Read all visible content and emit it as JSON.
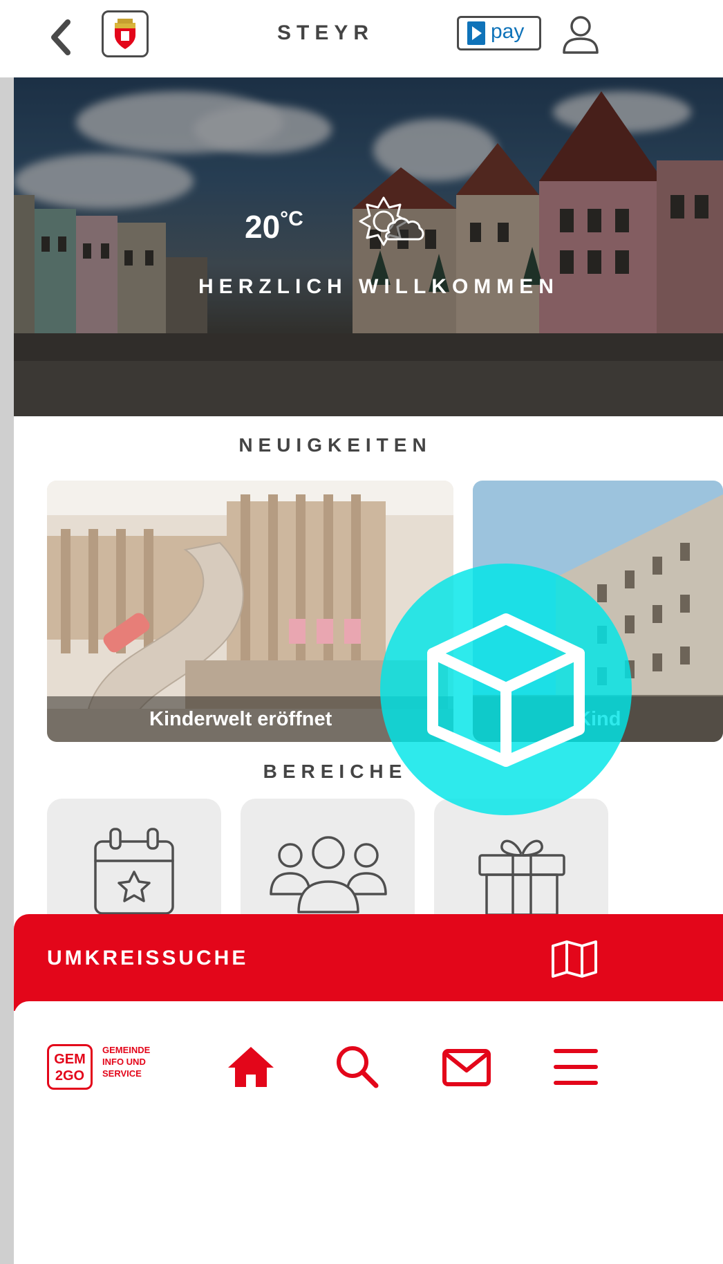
{
  "header": {
    "title": "STEYR",
    "pay_label": "pay"
  },
  "hero": {
    "temperature": "20",
    "temperature_unit": "°C",
    "welcome": "HERZLICH WILLKOMMEN"
  },
  "news": {
    "section_title": "NEUIGKEITEN",
    "cards": [
      {
        "caption": "Kinderwelt eröffnet"
      },
      {
        "caption": "Kind"
      }
    ]
  },
  "categories": {
    "section_title": "BEREICHE",
    "tiles": [
      {
        "icon": "calendar-star-icon"
      },
      {
        "icon": "group-icon"
      },
      {
        "icon": "gift-icon"
      }
    ]
  },
  "radius_search": {
    "label": "UMKREISSUCHE",
    "icon": "map-icon"
  },
  "brand": {
    "logo_line1": "GEM",
    "logo_line2": "2GO",
    "tagline1": "GEMEINDE",
    "tagline2": "INFO UND",
    "tagline3": "SERVICE"
  },
  "colors": {
    "accent_red": "#e3061a",
    "cyan_overlay": "#00e5e8",
    "pay_blue": "#0f73b9",
    "text_dark": "#444444"
  }
}
